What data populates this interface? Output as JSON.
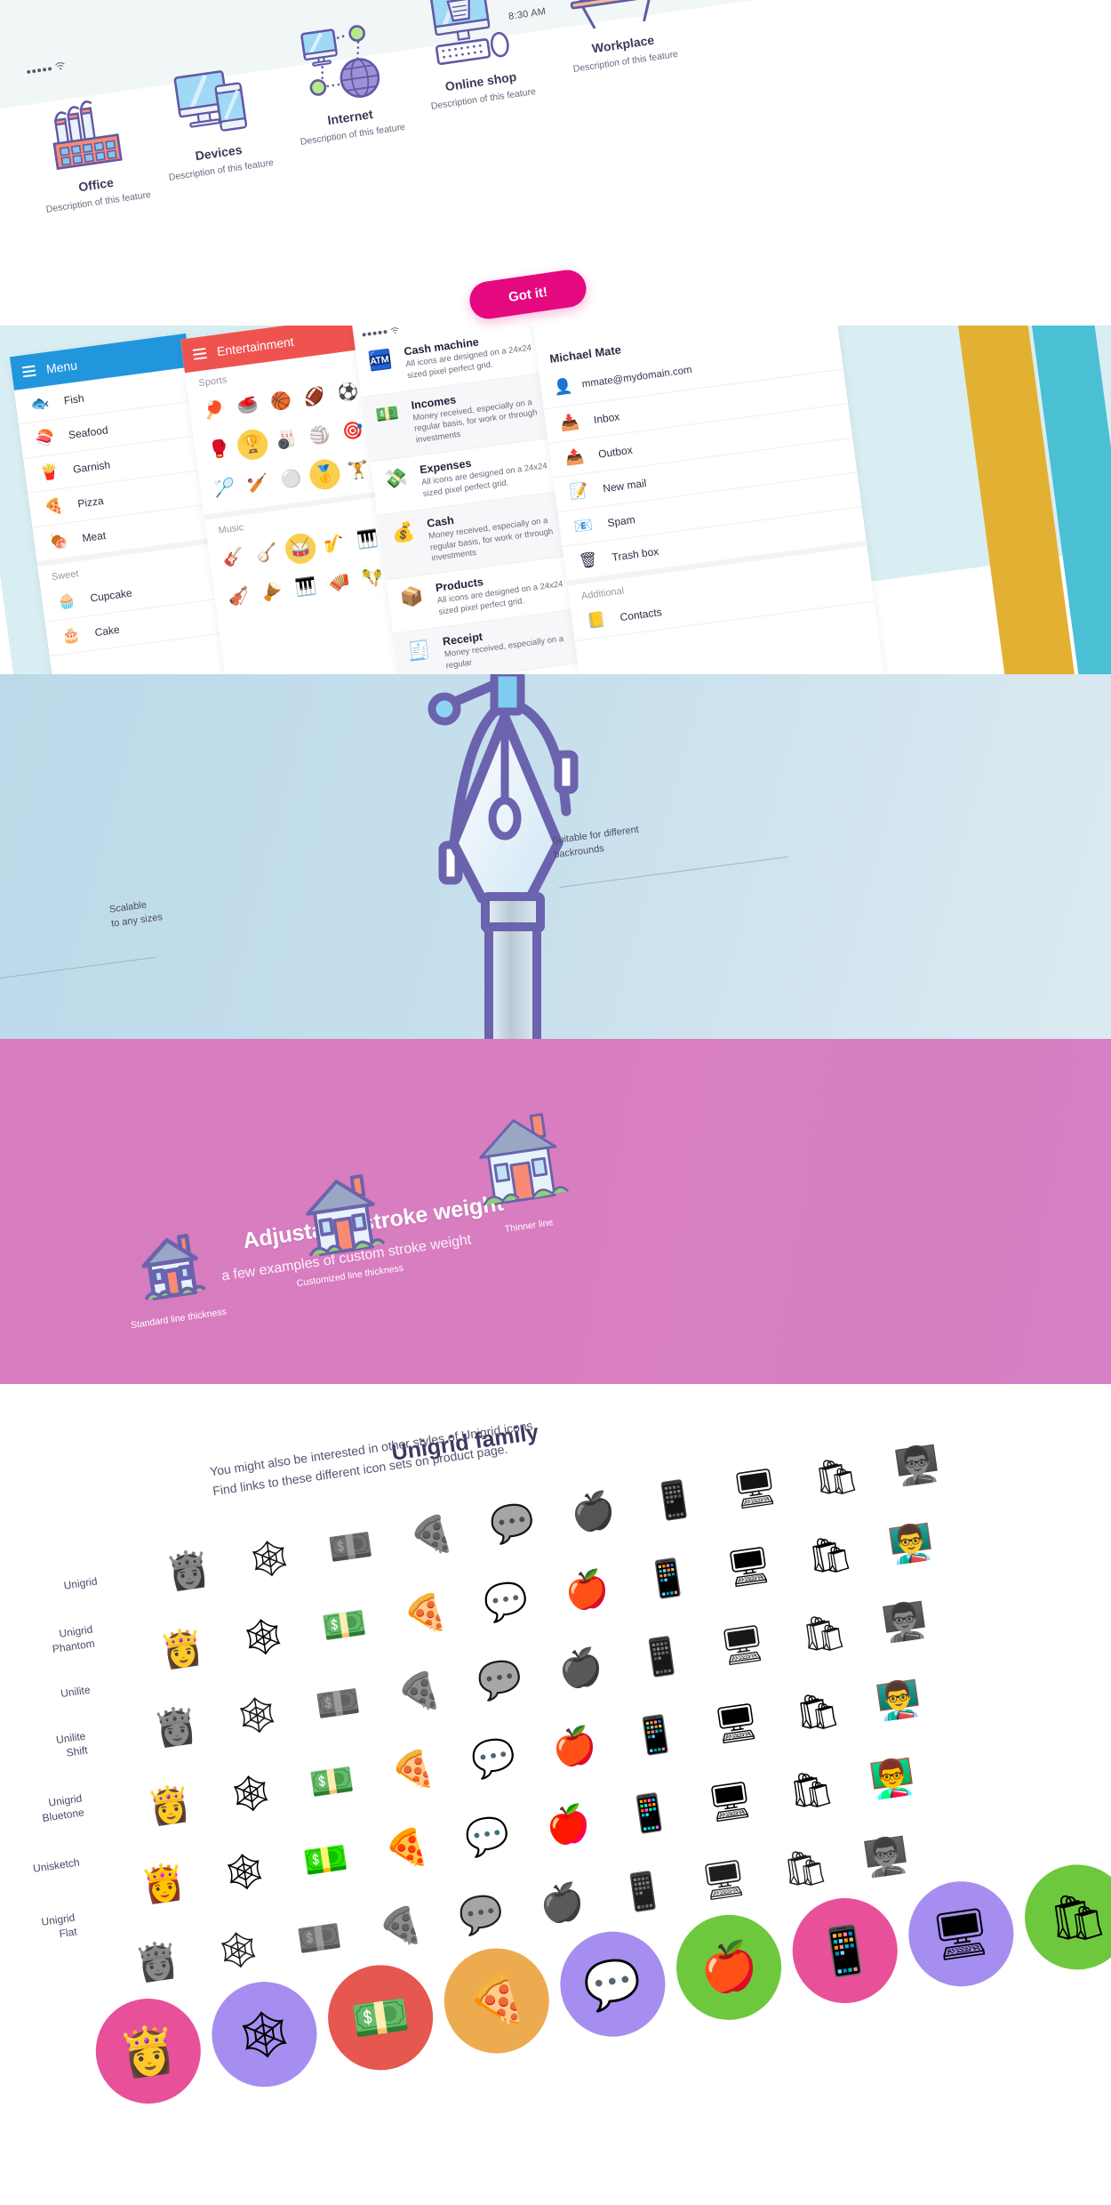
{
  "features_section": {
    "status_bar": {
      "signal_dots": 5,
      "wifi_icon": "wifi-icon"
    },
    "clock": "8:30 AM",
    "cta_button": "Got it!",
    "items": [
      {
        "title": "Office",
        "desc": "Description of this feature",
        "icon": "factory-icon"
      },
      {
        "title": "Devices",
        "desc": "Description of this feature",
        "icon": "desktop-mobile-icon"
      },
      {
        "title": "Internet",
        "desc": "Description of this feature",
        "icon": "network-globe-icon"
      },
      {
        "title": "Online shop",
        "desc": "Description of this feature",
        "icon": "shopping-computer-icon"
      },
      {
        "title": "Workplace",
        "desc": "Description of this feature",
        "icon": "desk-monitor-icon"
      }
    ]
  },
  "apps_section": {
    "menu_app": {
      "title": "Menu",
      "bar_color": "#2196dd",
      "items": [
        {
          "label": "Fish",
          "icon": "fish-icon"
        },
        {
          "label": "Seafood",
          "icon": "sushi-icon"
        },
        {
          "label": "Garnish",
          "icon": "fries-icon"
        },
        {
          "label": "Pizza",
          "icon": "pizza-icon"
        },
        {
          "label": "Meat",
          "icon": "meat-icon"
        }
      ],
      "section_label": "Sweet",
      "sweet_items": [
        {
          "label": "Cupcake",
          "icon": "cupcake-icon"
        },
        {
          "label": "Cake",
          "icon": "cake-icon"
        }
      ]
    },
    "entertainment_app": {
      "title": "Entertainment",
      "bar_color": "#ef5350",
      "groups": [
        {
          "label": "Sports",
          "rows": [
            [
              "ping-pong-icon",
              "kettlebell-icon",
              "basketball-icon",
              "rugby-ball-icon",
              "soccer-ball-icon"
            ],
            [
              "boxing-glove-icon",
              "trophy-icon",
              "bowling-ball-icon",
              "volleyball-icon",
              "dartboard-icon"
            ],
            [
              "badminton-icon",
              "baseball-bat-icon",
              "golf-ball-icon",
              "medal-icon",
              "dumbbell-icon"
            ]
          ],
          "highlighted": [
            "trophy-icon",
            "medal-icon"
          ]
        },
        {
          "label": "Music",
          "rows": [
            [
              "guitar-icon",
              "banjo-icon",
              "drum-icon",
              "saxophone-icon",
              "keyboard-synth-icon"
            ],
            [
              "violin-icon",
              "xylophone-icon",
              "piano-icon",
              "accordion-icon",
              "maracas-icon"
            ]
          ],
          "highlighted": [
            "drum-icon"
          ]
        }
      ]
    },
    "finance_app": {
      "status_bar": {
        "signal_dots": 5,
        "wifi_icon": "wifi-icon"
      },
      "rows": [
        {
          "title": "Cash machine",
          "desc": "All icons are designed on a 24x24 sized pixel perfect grid.",
          "icon": "cash-register-icon"
        },
        {
          "title": "Incomes",
          "desc": "Money received, especially on a regular basis, for work or through investments",
          "icon": "income-money-icon"
        },
        {
          "title": "Expenses",
          "desc": "All icons are designed on a 24x24 sized pixel perfect grid.",
          "icon": "expense-money-icon"
        },
        {
          "title": "Cash",
          "desc": "Money received, especially on a regular basis, for work or through investments",
          "icon": "cash-coins-icon"
        },
        {
          "title": "Products",
          "desc": "All icons are designed on a 24x24 sized pixel perfect grid.",
          "icon": "box-product-icon"
        },
        {
          "title": "Receipt",
          "desc": "Money received, especially on a regular",
          "icon": "receipt-icon"
        }
      ]
    },
    "mail_app": {
      "account_name": "Michael Mate",
      "account_email": "mmate@mydomain.com",
      "avatar_icon": "user-avatar-icon",
      "items": [
        {
          "label": "Inbox",
          "icon": "inbox-tray-icon"
        },
        {
          "label": "Outbox",
          "icon": "outbox-tray-icon"
        },
        {
          "label": "New mail",
          "icon": "compose-icon"
        },
        {
          "label": "Spam",
          "icon": "spam-envelope-icon"
        },
        {
          "label": "Trash box",
          "icon": "trash-icon"
        }
      ],
      "additional_label": "Additional",
      "additional_items": [
        {
          "label": "Contacts",
          "icon": "contacts-book-icon"
        }
      ]
    },
    "stripe_colors": [
      "#4bbfd4",
      "#e2b133",
      "#4bbfd4"
    ]
  },
  "pen_section": {
    "left_note": "Scalable\nto any sizes",
    "left_note_line1": "Scalable",
    "left_note_line2": "to any sizes",
    "right_note_line1": "Suitable for different",
    "right_note_line2": "backrounds",
    "pen_icon": "pen-nib-bezier-icon",
    "bg_from": "#bcd9e9",
    "bg_to": "#dceaf1"
  },
  "stroke_section": {
    "heading": "Adjustable stroke weight",
    "subheading": "a few examples of custom stroke weight",
    "bg_color": "#d77cc0",
    "examples": [
      {
        "label": "Standard line thickness",
        "icon": "house-icon",
        "stroke": 3.2,
        "size": 78
      },
      {
        "label": "Customized line thickness",
        "icon": "house-icon",
        "stroke": 2.3,
        "size": 96
      },
      {
        "label": "Thinner line",
        "icon": "house-icon",
        "stroke": 1.5,
        "size": 110
      }
    ]
  },
  "family_section": {
    "heading": "Unigrid family",
    "paragraph_line1": "You might also be interested in other styles of Unigrid icons.",
    "paragraph_line2": "Find links to these different icon sets on product page.",
    "row_labels": [
      "Unigrid",
      "Unigrid\nPhantom",
      "Unilite",
      "Unilite\nShift",
      "Unigrid\nBluetone",
      "Unisketch",
      "Unigrid\nFlat"
    ],
    "rows": [
      {
        "name": "Unigrid",
        "label_l1": "Unigrid",
        "label_l2": ""
      },
      {
        "name": "Unigrid Phantom",
        "label_l1": "Unigrid",
        "label_l2": "Phantom"
      },
      {
        "name": "Unilite",
        "label_l1": "Unilite",
        "label_l2": ""
      },
      {
        "name": "Unilite Shift",
        "label_l1": "Unilite",
        "label_l2": "Shift"
      },
      {
        "name": "Unigrid Bluetone",
        "label_l1": "Unigrid",
        "label_l2": "Bluetone"
      },
      {
        "name": "Unisketch",
        "label_l1": "Unisketch",
        "label_l2": ""
      },
      {
        "name": "Unigrid Flat",
        "label_l1": "Unigrid",
        "label_l2": "Flat"
      }
    ],
    "columns": [
      "woman-avatar-icon",
      "social-network-icon",
      "money-coins-icon",
      "pizza-icon",
      "group-chat-icon",
      "apple-measure-icon",
      "dating-phone-icon",
      "screen-sharing-icon",
      "grocery-bag-icon",
      "presentation-person-icon"
    ],
    "flat_circle_colors": [
      "#e8519a",
      "#a58ef0",
      "#e5574f",
      "#edab50",
      "#a58ef0",
      "#6ec83e",
      "#e8519a",
      "#a58ef0",
      "#6ec83e"
    ]
  }
}
